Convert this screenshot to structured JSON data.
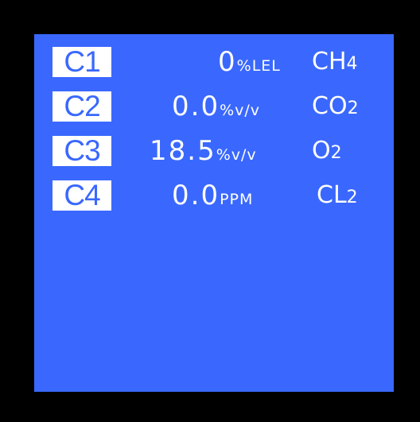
{
  "display": {
    "channels": [
      {
        "channel": "C1",
        "value": "0",
        "unit": "%LEL",
        "gas": "CH",
        "gas_sub": "4"
      },
      {
        "channel": "C2",
        "value": "0.0",
        "unit": "%v/v",
        "gas": "CO",
        "gas_sub": "2"
      },
      {
        "channel": "C3",
        "value": "18.5",
        "unit": "%v/v",
        "gas": "O",
        "gas_sub": "2"
      },
      {
        "channel": "C4",
        "value": "0.0",
        "unit": "PPM",
        "gas": "CL",
        "gas_sub": "2"
      }
    ],
    "colors": {
      "screen_background": "#3a68fe",
      "bezel": "#000000",
      "text": "#ffffff"
    }
  }
}
